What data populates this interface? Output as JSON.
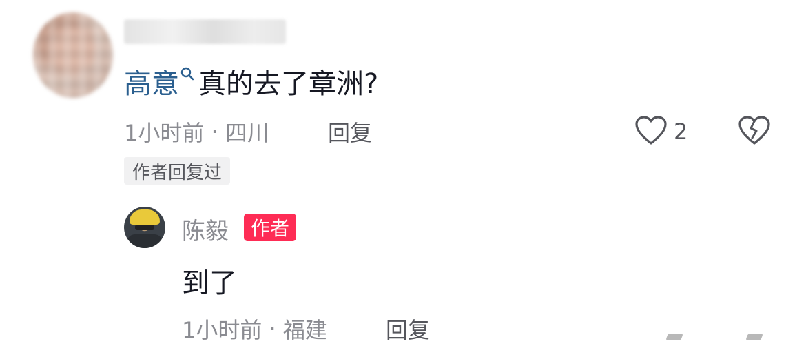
{
  "comment": {
    "mention": "高意",
    "text": "真的去了章洲?",
    "time": "1小时前",
    "separator": " · ",
    "location": "四川",
    "reply_label": "回复",
    "like_count": "2",
    "author_replied_tag": "作者回复过"
  },
  "reply": {
    "username": "陈毅",
    "badge": "作者",
    "text": "到了",
    "time": "1小时前",
    "separator": " · ",
    "location": "福建",
    "reply_label": "回复"
  },
  "icons": {
    "mention": "search-icon",
    "like": "heart-outline-icon",
    "dislike": "broken-heart-icon"
  },
  "colors": {
    "mention": "#2b5f8f",
    "author_badge": "#fe2c55",
    "meta_text": "#8a8b91"
  }
}
